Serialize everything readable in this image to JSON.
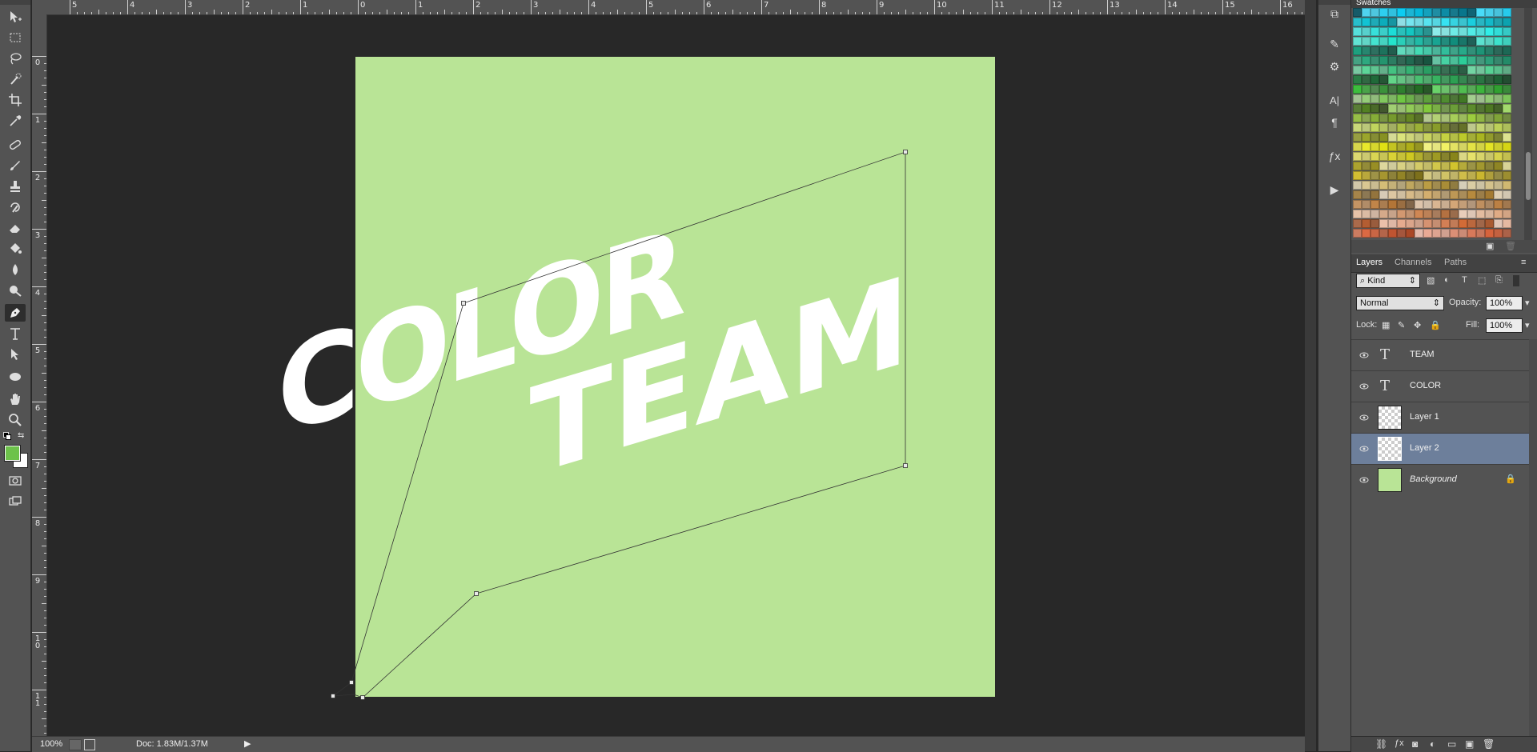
{
  "toolbar": {
    "tools": [
      "move-tool",
      "rect-marquee-tool",
      "lasso-tool",
      "quick-select-tool",
      "crop-tool",
      "eyedropper-tool",
      "healing-brush-tool",
      "brush-tool",
      "clone-stamp-tool",
      "history-brush-tool",
      "eraser-tool",
      "paint-bucket-tool",
      "blur-tool",
      "dodge-tool",
      "pen-tool",
      "type-tool",
      "path-select-tool",
      "ellipse-tool",
      "hand-tool",
      "zoom-tool"
    ],
    "active_tool": "pen-tool",
    "foreground_color": "#6dc24b",
    "background_color": "#ffffff"
  },
  "ruler": {
    "top": [
      "5",
      "4",
      "3",
      "2",
      "1",
      "0",
      "1",
      "2",
      "3",
      "4",
      "5",
      "6",
      "7",
      "8",
      "9",
      "10",
      "11",
      "12",
      "13",
      "14",
      "15",
      "16"
    ],
    "left": [
      "0",
      "1",
      "2",
      "3",
      "4",
      "5",
      "6",
      "7",
      "8",
      "9",
      "10",
      "11"
    ]
  },
  "canvas": {
    "artboard_color": "#b9e496",
    "artwork_text_line1": "COLOR",
    "artwork_text_line2": "TEAM",
    "text_color": "#ffffff"
  },
  "status": {
    "zoom": "100%",
    "doc_info": "Doc: 1.83M/1.37M"
  },
  "swatches": {
    "title": "Swatches"
  },
  "layers_panel": {
    "tabs": [
      "Layers",
      "Channels",
      "Paths"
    ],
    "active_tab": "Layers",
    "filter": "Kind",
    "blend_mode": "Normal",
    "opacity_label": "Opacity:",
    "opacity_value": "100%",
    "lock_label": "Lock:",
    "fill_label": "Fill:",
    "fill_value": "100%",
    "layers": [
      {
        "name": "TEAM",
        "type": "text",
        "selected": false
      },
      {
        "name": "COLOR",
        "type": "text",
        "selected": false
      },
      {
        "name": "Layer 1",
        "type": "pixel",
        "selected": false
      },
      {
        "name": "Layer 2",
        "type": "pixel",
        "selected": true
      },
      {
        "name": "Background",
        "type": "background",
        "selected": false,
        "locked": true
      }
    ]
  }
}
